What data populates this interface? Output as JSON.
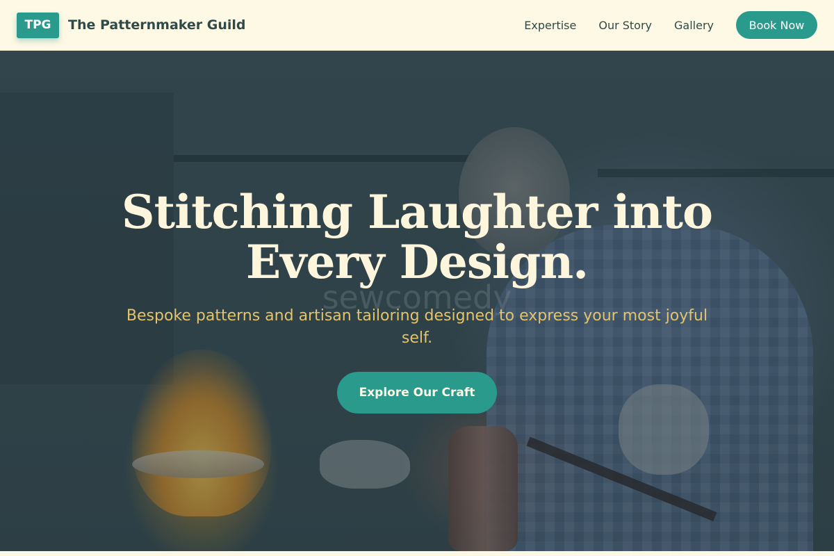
{
  "header": {
    "logo_text": "TPG",
    "brand_name": "The Patternmaker Guild",
    "nav": [
      {
        "label": "Expertise"
      },
      {
        "label": "Our Story"
      },
      {
        "label": "Gallery"
      }
    ],
    "cta_label": "Book Now"
  },
  "hero": {
    "title": "Stitching Laughter into Every Design.",
    "watermark": "sewcomedy",
    "subtitle": "Bespoke patterns and artisan tailoring designed to express your most joyful self.",
    "cta_label": "Explore Our Craft"
  },
  "colors": {
    "accent": "#2a9a8d",
    "header_bg": "#fef9e4",
    "title": "#fdf5dc",
    "subtitle": "#e2c46e",
    "text_dark": "#2f4a48"
  },
  "icons": []
}
